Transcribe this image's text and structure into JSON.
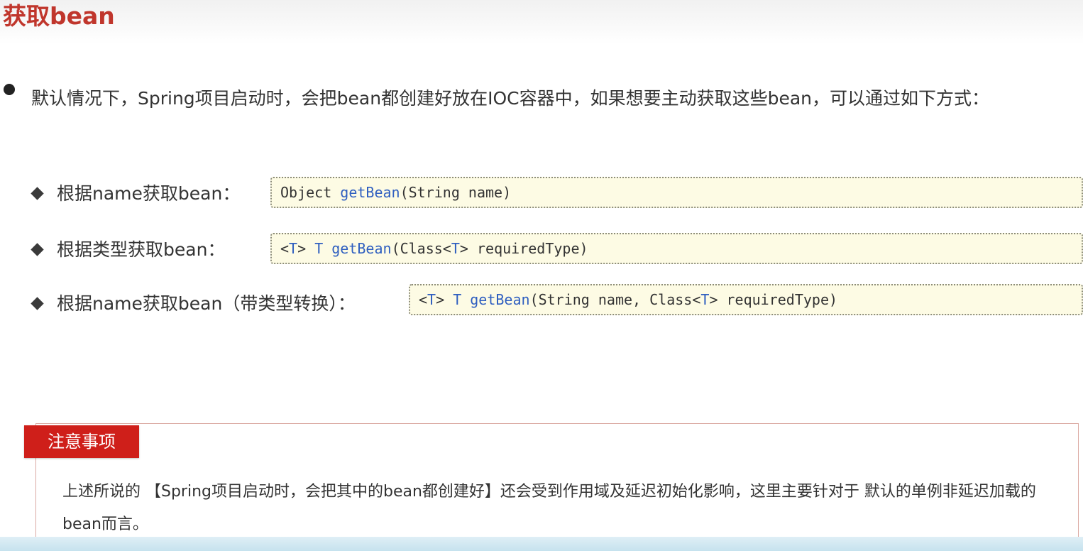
{
  "title": "获取bean",
  "intro": "默认情况下，Spring项目启动时，会把bean都创建好放在IOC容器中，如果想要主动获取这些bean，可以通过如下方式：",
  "methods": [
    {
      "label": "根据name获取bean：",
      "code": [
        "Object ",
        "getBean",
        "(String name)"
      ]
    },
    {
      "label": "根据类型获取bean：",
      "code": [
        "<",
        "T",
        "> ",
        "T getBean",
        "(Class<",
        "T",
        "> requiredType)"
      ]
    },
    {
      "label": "根据name获取bean（带类型转换）：",
      "code": [
        "<",
        "T",
        "> ",
        "T getBean",
        "(String name, Class<",
        "T",
        "> requiredType)"
      ]
    }
  ],
  "note": {
    "tag": "注意事项",
    "text": "上述所说的 【Spring项目启动时，会把其中的bean都创建好】还会受到作用域及延迟初始化影响，这里主要针对于 默认的单例非延迟加载的bean而言。"
  },
  "colors": {
    "title": "#c0362c",
    "code_keyword": "#2f5fc0",
    "note_tag": "#cf1f1a"
  }
}
